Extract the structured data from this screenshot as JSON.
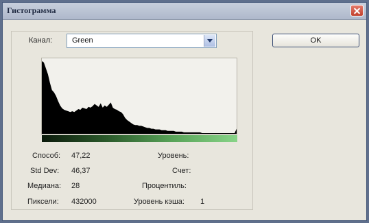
{
  "window": {
    "title": "Гистограмма"
  },
  "channel": {
    "label": "Канал:",
    "value": "Green"
  },
  "ok_button": "OK",
  "stats": {
    "mean_label": "Способ:",
    "mean_value": "47,22",
    "std_label": "Std Dev:",
    "std_value": "46,37",
    "median_label": "Медиана:",
    "median_value": "28",
    "pixels_label": "Пиксели:",
    "pixels_value": "432000",
    "level_label": "Уровень:",
    "level_value": "",
    "count_label": "Счет:",
    "count_value": "",
    "percentile_label": "Процентиль:",
    "percentile_value": "",
    "cache_label": "Уровень кэша:",
    "cache_value": "1"
  },
  "histogram": {
    "type": "area",
    "bins": 256,
    "series": [
      {
        "values": [
          1.0,
          0.98,
          0.9,
          0.82,
          0.7,
          0.6,
          0.57,
          0.52,
          0.45,
          0.39,
          0.35,
          0.33,
          0.32,
          0.31,
          0.3,
          0.31,
          0.3,
          0.32,
          0.34,
          0.33,
          0.36,
          0.35,
          0.34,
          0.37,
          0.36,
          0.38,
          0.41,
          0.39,
          0.37,
          0.42,
          0.36,
          0.39,
          0.37,
          0.4,
          0.43,
          0.36,
          0.34,
          0.33,
          0.31,
          0.3,
          0.27,
          0.22,
          0.19,
          0.17,
          0.15,
          0.13,
          0.12,
          0.12,
          0.11,
          0.11,
          0.1,
          0.09,
          0.08,
          0.08,
          0.07,
          0.07,
          0.06,
          0.06,
          0.06,
          0.05,
          0.05,
          0.05,
          0.04,
          0.04,
          0.04,
          0.04,
          0.03,
          0.03,
          0.03,
          0.03,
          0.02,
          0.02,
          0.02,
          0.02,
          0.02,
          0.02,
          0.02,
          0.02,
          0.02,
          0.01,
          0.01,
          0.01,
          0.01,
          0.01,
          0.01,
          0.01,
          0.01,
          0.01,
          0.01,
          0.01,
          0.01,
          0.01,
          0.01,
          0.01,
          0.01,
          0.01,
          0.07
        ]
      }
    ],
    "gradient_colors": [
      "#0b1a0b",
      "#58a358",
      "#88d488"
    ],
    "fill_color": "#000000"
  }
}
